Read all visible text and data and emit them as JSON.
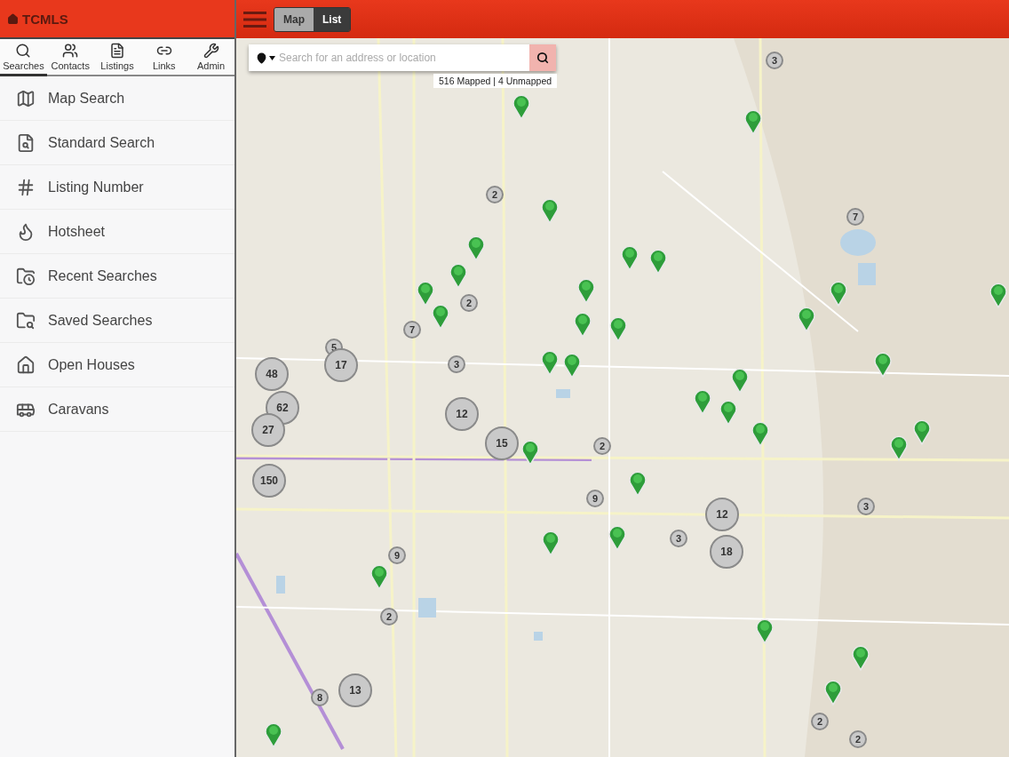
{
  "app": {
    "title": "TCMLS"
  },
  "view_toggle": [
    {
      "label": "Map",
      "selected": true
    },
    {
      "label": "List",
      "selected": false
    }
  ],
  "tabs": [
    {
      "label": "Searches",
      "kind": "searches",
      "selected": true
    },
    {
      "label": "Contacts",
      "kind": "contacts",
      "selected": false
    },
    {
      "label": "Listings",
      "kind": "listings",
      "selected": false
    },
    {
      "label": "Links",
      "kind": "links",
      "selected": false
    },
    {
      "label": "Admin",
      "kind": "admin",
      "selected": false
    }
  ],
  "menu": [
    {
      "label": "Map Search",
      "kind": "map"
    },
    {
      "label": "Standard Search",
      "kind": "standard"
    },
    {
      "label": "Listing Number",
      "kind": "number"
    },
    {
      "label": "Hotsheet",
      "kind": "hotsheet"
    },
    {
      "label": "Recent Searches",
      "kind": "recent"
    },
    {
      "label": "Saved Searches",
      "kind": "saved"
    },
    {
      "label": "Open Houses",
      "kind": "open"
    },
    {
      "label": "Caravans",
      "kind": "caravan"
    }
  ],
  "search": {
    "placeholder": "Search for an address or location"
  },
  "map_status": "516 Mapped | 4 Unmapped",
  "clusters": [
    {
      "count": "3",
      "kind": "small"
    },
    {
      "count": "2",
      "kind": "small"
    },
    {
      "count": "7",
      "kind": "small"
    },
    {
      "count": "2",
      "kind": "small"
    },
    {
      "count": "7",
      "kind": "small"
    },
    {
      "count": "5",
      "kind": "small"
    },
    {
      "count": "17",
      "kind": "large"
    },
    {
      "count": "3",
      "kind": "small"
    },
    {
      "count": "48",
      "kind": "large"
    },
    {
      "count": "12",
      "kind": "large"
    },
    {
      "count": "62",
      "kind": "large"
    },
    {
      "count": "27",
      "kind": "large"
    },
    {
      "count": "15",
      "kind": "large"
    },
    {
      "count": "2",
      "kind": "small"
    },
    {
      "count": "150",
      "kind": "large"
    },
    {
      "count": "9",
      "kind": "small"
    },
    {
      "count": "12",
      "kind": "large"
    },
    {
      "count": "3",
      "kind": "small"
    },
    {
      "count": "3",
      "kind": "small"
    },
    {
      "count": "18",
      "kind": "large"
    },
    {
      "count": "9",
      "kind": "small"
    },
    {
      "count": "2",
      "kind": "small"
    },
    {
      "count": "13",
      "kind": "large"
    },
    {
      "count": "8",
      "kind": "small"
    },
    {
      "count": "2",
      "kind": "small"
    },
    {
      "count": "2",
      "kind": "small"
    }
  ]
}
